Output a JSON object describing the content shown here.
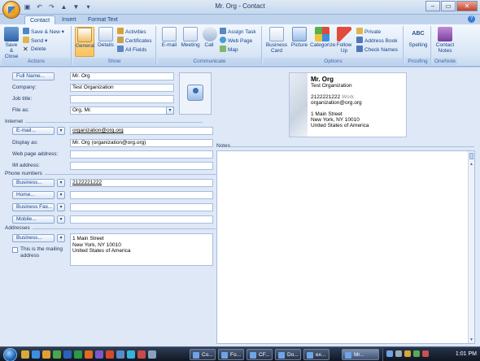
{
  "window": {
    "title": "Mr. Org - Contact",
    "buttons": {
      "minimize": "–",
      "maximize": "▭",
      "close": "✕"
    }
  },
  "quick_access": [
    "save-icon",
    "undo-icon",
    "redo-icon",
    "up-icon",
    "down-icon",
    "customize-icon"
  ],
  "tabs": [
    {
      "label": "Contact",
      "active": true
    },
    {
      "label": "Insert",
      "active": false
    },
    {
      "label": "Format Text",
      "active": false
    }
  ],
  "ribbon": {
    "actions": {
      "label": "Actions",
      "save_close": "Save & Close",
      "save_new": "Save & New",
      "send": "Send",
      "delete": "Delete"
    },
    "show": {
      "label": "Show",
      "general": "General",
      "details": "Details",
      "activities": "Activities",
      "certificates": "Certificates",
      "all_fields": "All Fields"
    },
    "communicate": {
      "label": "Communicate",
      "email": "E-mail",
      "meeting": "Meeting",
      "call": "Call",
      "assign_task": "Assign Task",
      "web_page": "Web Page",
      "map": "Map"
    },
    "options": {
      "label": "Options",
      "business_card": "Business Card",
      "picture": "Picture",
      "categorize": "Categorize",
      "follow_up": "Follow Up",
      "private": "Private",
      "address_book": "Address Book",
      "check_names": "Check Names"
    },
    "proofing": {
      "label": "Proofing",
      "spelling": "Spelling"
    },
    "onenote": {
      "label": "OneNote",
      "contact_notes": "Contact Notes"
    }
  },
  "form": {
    "full_name_button": "Full Name...",
    "full_name": "Mr. Org",
    "company_label": "Company:",
    "company": "Test Organization",
    "job_title_label": "Job title:",
    "job_title": "",
    "file_as_label": "File as:",
    "file_as": "Org, Mr.",
    "internet_section": "Internet",
    "email_button": "E-mail...",
    "email": "organization@org.org",
    "display_as_label": "Display as:",
    "display_as": "Mr. Org (organization@org.org)",
    "web_page_label": "Web page address:",
    "web_page": "",
    "im_label": "IM address:",
    "im": "",
    "phone_section": "Phone numbers",
    "phone_business_button": "Business...",
    "phone_business": "2122221222",
    "phone_home_button": "Home...",
    "phone_home": "",
    "phone_fax_button": "Business Fax...",
    "phone_fax": "",
    "phone_mobile_button": "Mobile...",
    "phone_mobile": "",
    "addresses_section": "Addresses",
    "address_button": "Business...",
    "address_lines": [
      "1 Main Street",
      "New York, NY 10010",
      "United States of America"
    ],
    "mailing_checkbox": "This is the mailing address",
    "notes_label": "Notes"
  },
  "business_card": {
    "name": "Mr. Org",
    "company": "Test Organization",
    "phone": "2122221222",
    "phone_type": "Work",
    "email": "organization@org.org",
    "address_lines": [
      "1 Main Street",
      "New York, NY 10010",
      "United States of America"
    ]
  },
  "taskbar": {
    "tasks": [
      "Co...",
      "Fo...",
      "CF...",
      "Do...",
      "ex...",
      "Mr..."
    ],
    "clock": "1:01 PM"
  },
  "colors": {
    "accent": "#15428b",
    "ribbon_bg": "#d9e6f6",
    "form_bg": "#dfe8f6",
    "selected_button": "#f9c35e"
  }
}
